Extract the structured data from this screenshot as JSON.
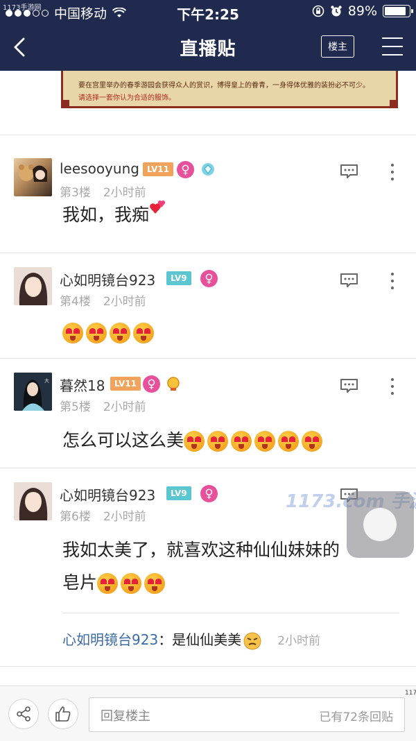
{
  "status_bar": {
    "carrier": "中国移动",
    "time": "下午2:25",
    "battery_percent": "89%",
    "battery_level": 0.89,
    "watermark": "1173手游网"
  },
  "nav": {
    "title": "直播贴",
    "owner_button": "楼主"
  },
  "banner": {
    "line1": "要在宫里举办的春季游园会获得众人的赏识，博得皇上的眷青，一身得体优雅的装扮必不可少。",
    "line2": "请选择一套你认为合适的服饰。"
  },
  "posts": [
    {
      "username": "leesooyung",
      "level": "LV11",
      "floor": "第3楼",
      "time": "2小时前",
      "text": "我如，我痴"
    },
    {
      "username": "心如明镜台923",
      "level": "LV9",
      "floor": "第4楼",
      "time": "2小时前",
      "text": ""
    },
    {
      "username": "暮然18",
      "level": "LV11",
      "floor": "第5楼",
      "time": "2小时前",
      "text": "怎么可以这么美"
    },
    {
      "username": "心如明镜台923",
      "level": "LV9",
      "floor": "第6楼",
      "time": "2小时前",
      "text_line1": "我如太美了，就喜欢这种仙仙妹妹的",
      "text_line2": "皂片",
      "reply": {
        "name": "心如明镜台923",
        "text": "：是仙仙美美",
        "time": "2小时前"
      }
    }
  ],
  "watermark_overlay": "1173.com 手游网",
  "bottom_bar": {
    "input_placeholder": "回复楼主",
    "reply_count": "已有72条回贴",
    "edge_mark": "117"
  },
  "colors": {
    "nav_bg": "#1f2a4e",
    "female_badge": "#e9509b",
    "level_orange": "#f2a35b",
    "level_teal": "#5cc6d0",
    "reply_name": "#3c6aa6"
  }
}
